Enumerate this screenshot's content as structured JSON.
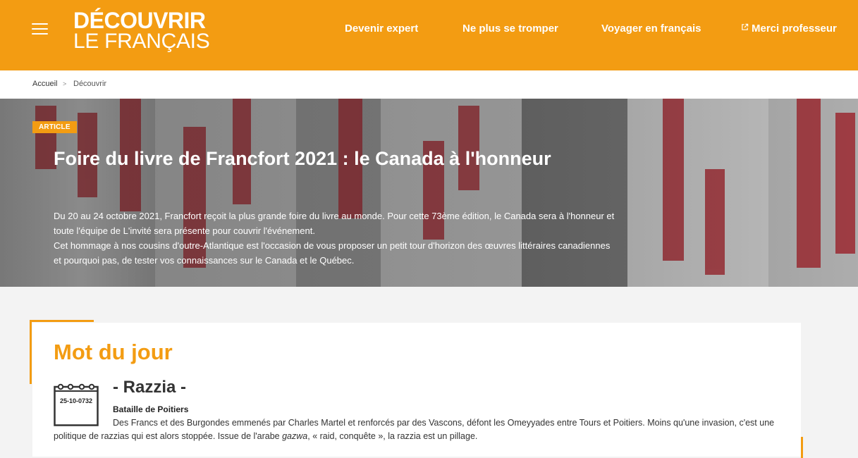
{
  "header": {
    "logo_line1": "DÉCOUVRIR",
    "logo_line2": "LE FRANÇAIS",
    "nav": [
      {
        "label": "Devenir expert"
      },
      {
        "label": "Ne plus se tromper"
      },
      {
        "label": "Voyager en français"
      },
      {
        "label": "Merci professeur",
        "icon": "external-link-icon"
      }
    ],
    "menu_icon": "hamburger-menu-icon",
    "colors": {
      "brand": "#f39c12",
      "text_on_brand": "#ffffff"
    }
  },
  "breadcrumb": {
    "home": "Accueil",
    "separator": ">",
    "current": "Découvrir"
  },
  "hero": {
    "badge": "ARTICLE",
    "title": "Foire du livre de Francfort 2021 : le Canada à l'honneur",
    "paragraph1": "Du 20 au 24 octobre 2021, Francfort reçoit la plus grande foire du livre au monde. Pour cette 73ème édition, le Canada sera à l'honneur et toute l'équipe de L'invité sera présente pour couvrir l'événement.",
    "paragraph2": "Cet hommage à nos cousins d'outre-Atlantique est l'occasion de vous proposer un petit tour d'horizon des œuvres littéraires canadiennes et pourquoi pas, de tester vos connaissances sur le Canada et le Québec."
  },
  "word_of_day": {
    "heading": "Mot du jour",
    "date": "25-10-0732",
    "word": "- Razzia -",
    "subtitle": "Bataille de Poitiers",
    "definition_part1": "Des Francs et des Burgondes emmenés par Charles Martel et renforcés par des Vascons, défont les Omeyyades entre Tours et Poitiers. Moins qu'une invasion, c'est une politique de razzias qui est alors stoppée. Issue de l'arabe ",
    "definition_italic": "gazwa",
    "definition_part2": ", « raid, conquête », la razzia est un pillage.",
    "calendar_icon": "calendar-icon"
  }
}
